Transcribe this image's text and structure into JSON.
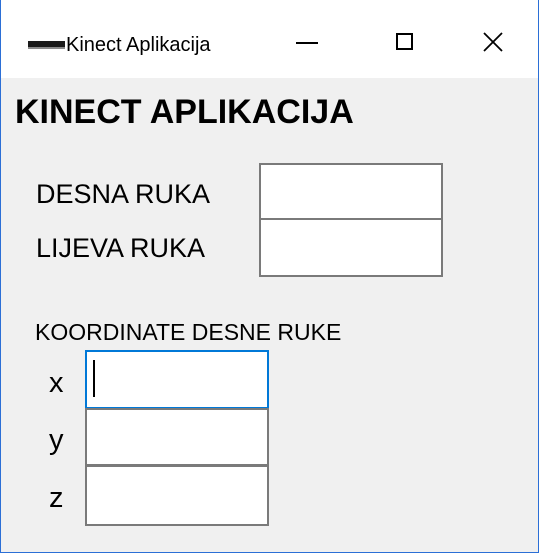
{
  "window": {
    "title": "Kinect Aplikacija",
    "controls": {
      "minimize": "minimize",
      "maximize": "maximize",
      "close": "close"
    }
  },
  "main": {
    "heading": "KINECT APLIKACIJA",
    "right_hand_label": "DESNA RUKA",
    "left_hand_label": "LIJEVA RUKA",
    "right_hand_value": "",
    "left_hand_value": "",
    "coordinates_label": "KOORDINATE DESNE RUKE",
    "coordinates": [
      {
        "axis": "x",
        "value": ""
      },
      {
        "axis": "y",
        "value": ""
      },
      {
        "axis": "z",
        "value": ""
      }
    ]
  },
  "colors": {
    "focus_border": "#0078d7",
    "window_border": "#2b6fd6",
    "form_background": "#f0f0f0"
  }
}
